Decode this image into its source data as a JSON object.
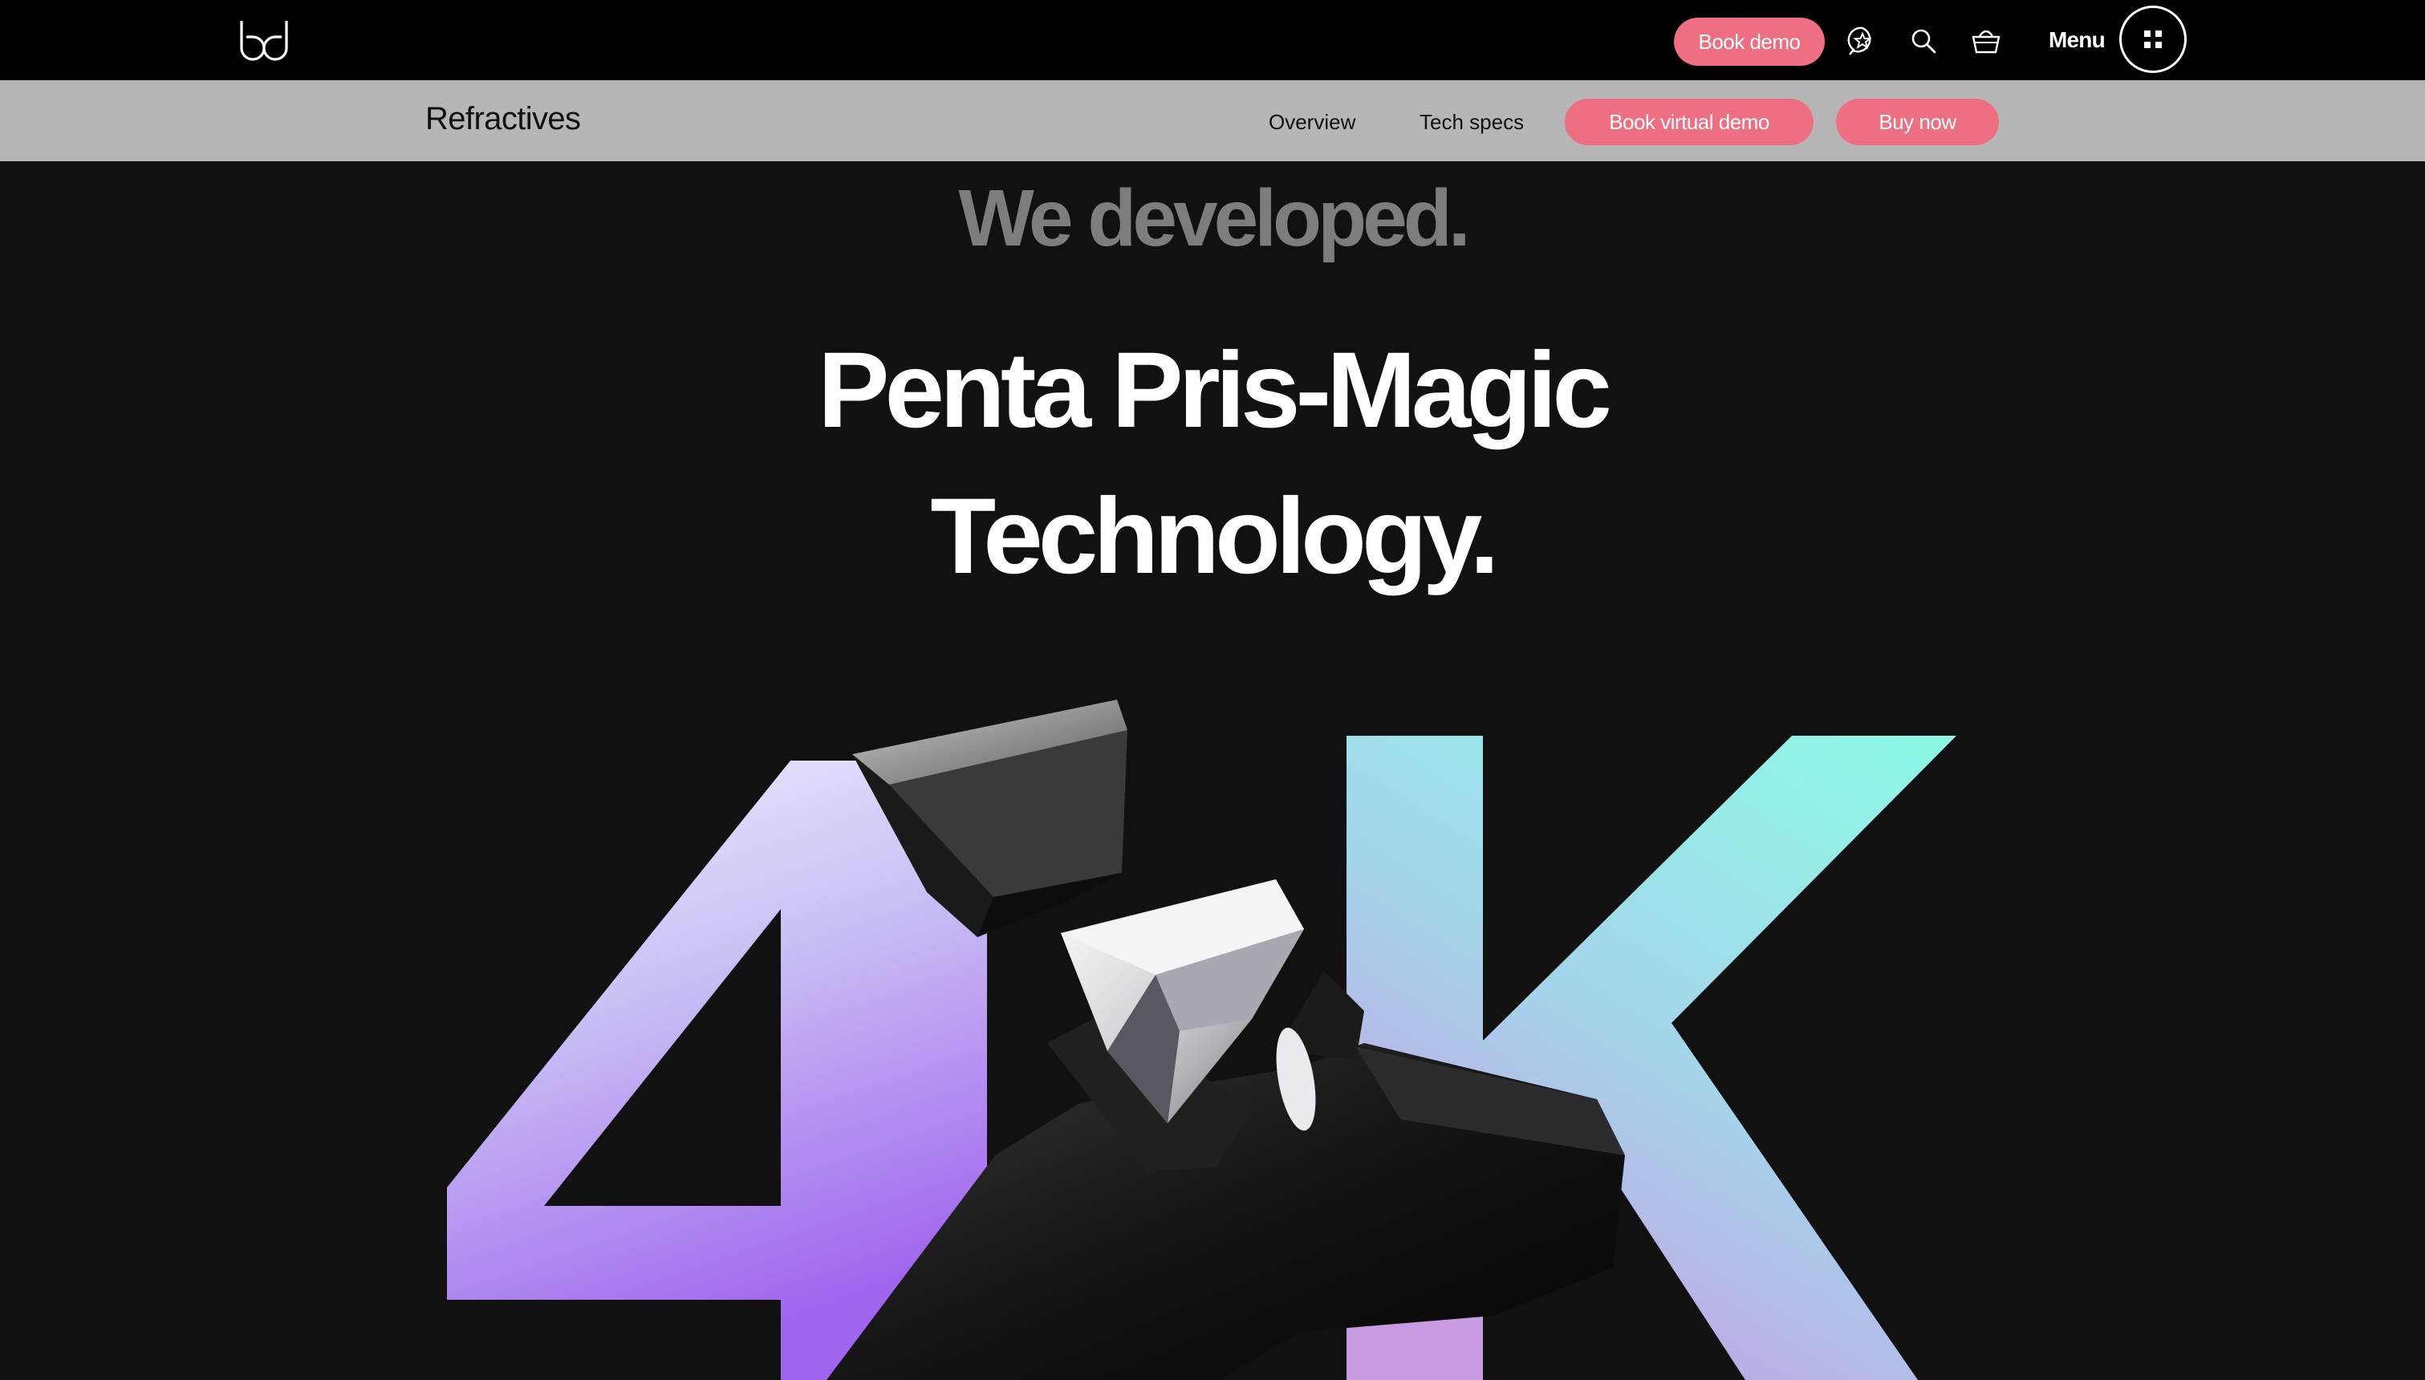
{
  "topbar": {
    "logo_alt": "bd",
    "book_demo_label": "Book demo",
    "menu_label": "Menu",
    "icons": [
      "reviews-star-icon",
      "search-icon",
      "basket-icon",
      "grid-menu-icon"
    ]
  },
  "subnav": {
    "title": "Refractives",
    "links": [
      "Overview",
      "Tech specs"
    ],
    "book_virtual_demo_label": "Book virtual demo",
    "buy_now_label": "Buy now"
  },
  "hero": {
    "kicker": "We developed.",
    "title_line1": "Penta Pris-Magic",
    "title_line2": "Technology."
  },
  "colors": {
    "accent_pink": "#ee6e82",
    "topbar_bg": "#000000",
    "subnav_bg": "#b6b6b6",
    "page_bg": "#111111",
    "gradient_purple": "#a26ef0",
    "gradient_mint": "#8ef5e6"
  }
}
